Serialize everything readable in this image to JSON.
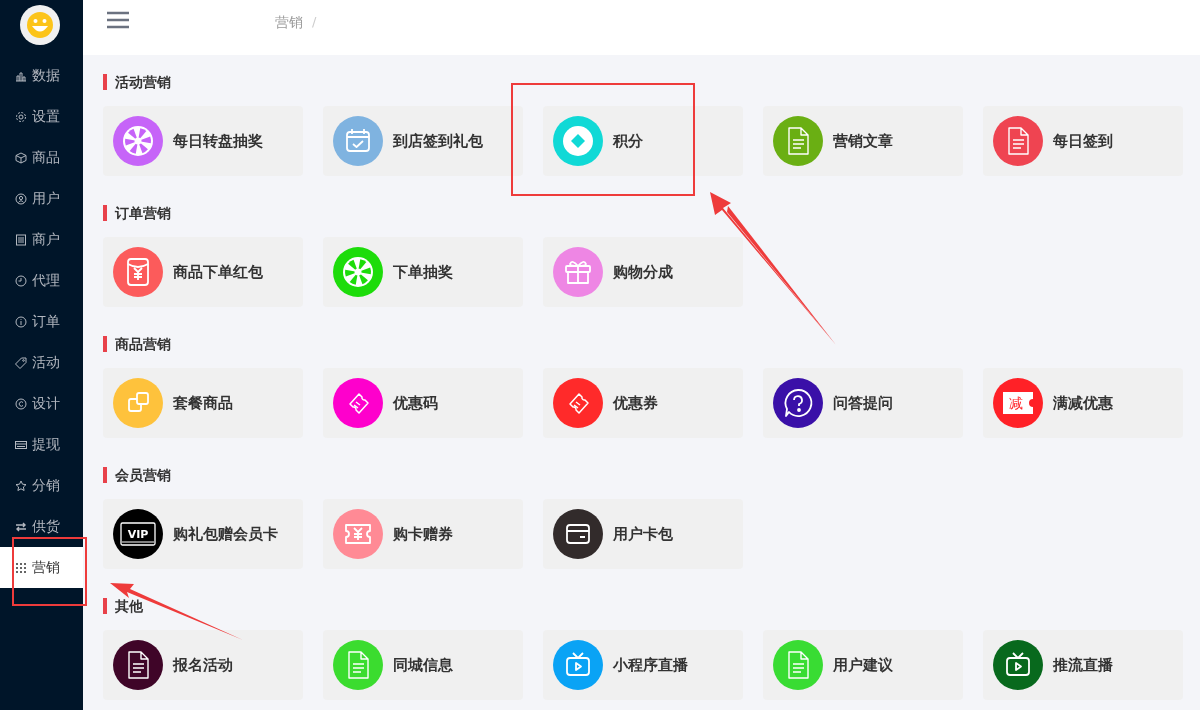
{
  "sidebar": {
    "items": [
      {
        "label": "数据",
        "selected": false
      },
      {
        "label": "设置",
        "selected": false
      },
      {
        "label": "商品",
        "selected": false
      },
      {
        "label": "用户",
        "selected": false
      },
      {
        "label": "商户",
        "selected": false
      },
      {
        "label": "代理",
        "selected": false
      },
      {
        "label": "订单",
        "selected": false
      },
      {
        "label": "活动",
        "selected": false
      },
      {
        "label": "设计",
        "selected": false
      },
      {
        "label": "提现",
        "selected": false
      },
      {
        "label": "分销",
        "selected": false
      },
      {
        "label": "供货",
        "selected": false
      },
      {
        "label": "营销",
        "selected": true
      }
    ]
  },
  "header": {
    "breadcrumb": [
      {
        "label": "营销",
        "separator": "/"
      }
    ]
  },
  "sections": [
    {
      "title": "活动营销",
      "items": [
        {
          "label": "每日转盘抽奖",
          "color": "#c664f8"
        },
        {
          "label": "到店签到礼包",
          "color": "#7fb3e0"
        },
        {
          "label": "积分",
          "color": "#10d9d6"
        },
        {
          "label": "营销文章",
          "color": "#6aaf13"
        },
        {
          "label": "每日签到",
          "color": "#ef4451"
        }
      ]
    },
    {
      "title": "订单营销",
      "items": [
        {
          "label": "商品下单红包",
          "color": "#fc5b5b"
        },
        {
          "label": "下单抽奖",
          "color": "#1ddc0a"
        },
        {
          "label": "购物分成",
          "color": "#ee86e4"
        }
      ]
    },
    {
      "title": "商品营销",
      "items": [
        {
          "label": "套餐商品",
          "color": "#fec23c"
        },
        {
          "label": "优惠码",
          "color": "#fe00cc"
        },
        {
          "label": "优惠券",
          "color": "#ff2a2a"
        },
        {
          "label": "问答提问",
          "color": "#3a10a8"
        },
        {
          "label": "满减优惠",
          "color": "#ff2127",
          "badge": "减"
        }
      ]
    },
    {
      "title": "会员营销",
      "items": [
        {
          "label": "购礼包赠会员卡",
          "color": "#000000",
          "badge": "VIP"
        },
        {
          "label": "购卡赠券",
          "color": "#ff8a95"
        },
        {
          "label": "用户卡包",
          "color": "#322b2b"
        }
      ]
    },
    {
      "title": "其他",
      "items": [
        {
          "label": "报名活动",
          "color": "#3f0528"
        },
        {
          "label": "同城信息",
          "color": "#3bdc2f"
        },
        {
          "label": "小程序直播",
          "color": "#0aa3f5"
        },
        {
          "label": "用户建议",
          "color": "#39dc33"
        },
        {
          "label": "推流直播",
          "color": "#08691d"
        }
      ]
    }
  ]
}
